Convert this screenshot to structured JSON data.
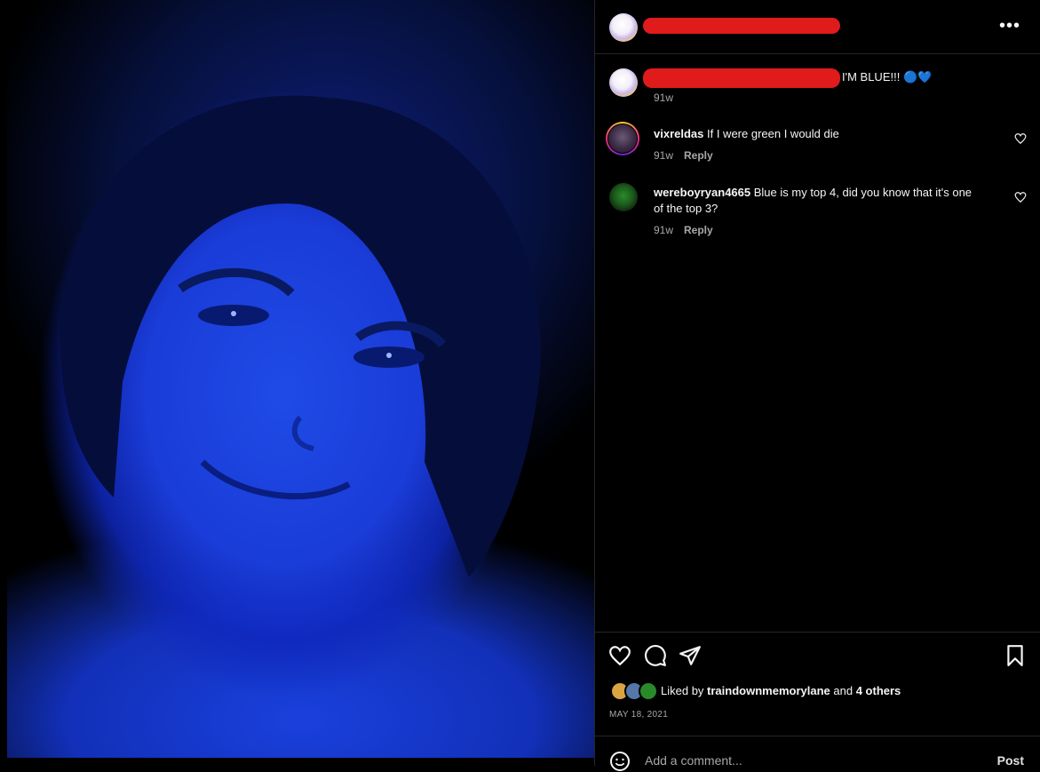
{
  "post": {
    "caption": "I'M BLUE!!! 🔵💙",
    "time": "91w",
    "more_glyph": "•••"
  },
  "comments": [
    {
      "user": "vixreldas",
      "text": "If I were green I would die",
      "time": "91w",
      "reply": "Reply"
    },
    {
      "user": "wereboyryan4665",
      "text": "Blue is my top 4, did you know that it's one",
      "text2": "of the top 3?",
      "time": "91w",
      "reply": "Reply"
    }
  ],
  "likes": {
    "prefix": "Liked by",
    "user": "traindownmemorylane",
    "and": "and",
    "others": "4 others"
  },
  "date": "MAY 18, 2021",
  "comment_box": {
    "placeholder": "Add a comment...",
    "post_label": "Post"
  },
  "colors": {
    "redaction": "#e01b1b",
    "background": "#000000",
    "muted": "#a8a8a8"
  }
}
